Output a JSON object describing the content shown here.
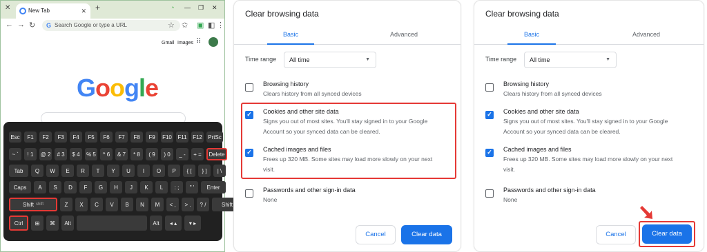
{
  "browser": {
    "tab_title": "New Tab",
    "tab_close": "✕",
    "new_tab": "+",
    "omnibox_placeholder": "Search Google or type a URL",
    "links": {
      "gmail": "Gmail",
      "images": "Images"
    },
    "logo_letters": [
      {
        "ch": "G",
        "color": "#4285f4"
      },
      {
        "ch": "o",
        "color": "#ea4335"
      },
      {
        "ch": "o",
        "color": "#fbbc05"
      },
      {
        "ch": "g",
        "color": "#4285f4"
      },
      {
        "ch": "l",
        "color": "#34a853"
      },
      {
        "ch": "e",
        "color": "#ea4335"
      }
    ],
    "frame_color": "#dfe9d6"
  },
  "keyboard": {
    "rows": [
      [
        "Esc",
        "F1",
        "F2",
        "F3",
        "F4",
        "F5",
        "F6",
        "F7",
        "F8",
        "F9",
        "F10",
        "F11",
        "F12",
        "PrtSc"
      ],
      [
        "~ `",
        "! 1",
        "@ 2",
        "# 3",
        "$ 4",
        "% 5",
        "^ 6",
        "& 7",
        "* 8",
        "( 9",
        ") 0",
        "_ -",
        "+ =",
        "Delete"
      ],
      [
        "Tab",
        "Q",
        "W",
        "E",
        "R",
        "T",
        "Y",
        "U",
        "I",
        "O",
        "P",
        "{ [",
        "} ]",
        "| \\"
      ],
      [
        "Caps",
        "A",
        "S",
        "D",
        "F",
        "G",
        "H",
        "J",
        "K",
        "L",
        ": ;",
        "\" '",
        "Enter"
      ],
      [
        "Shift",
        "Z",
        "X",
        "C",
        "V",
        "B",
        "N",
        "M",
        "< ,",
        "> .",
        "? /",
        "Shift"
      ],
      [
        "Ctrl",
        "⊞",
        "⌘",
        "Alt",
        "",
        "Alt",
        "◂ ▴",
        "▾ ▸"
      ]
    ],
    "shift_sub": "shift",
    "highlighted": [
      "Delete",
      "Shift",
      "Ctrl"
    ]
  },
  "dialog_left": {
    "title": "Clear browsing data",
    "tabs": [
      "Basic",
      "Advanced"
    ],
    "time_range_label": "Time range",
    "time_range_value": "All time",
    "items": [
      {
        "title": "Browsing history",
        "desc": "Clears history from all synced devices",
        "checked": false
      },
      {
        "title": "Cookies and other site data",
        "desc": "Signs you out of most sites. You'll stay signed in to your Google Account so your synced data can be cleared.",
        "checked": true
      },
      {
        "title": "Cached images and files",
        "desc": "Frees up 320 MB. Some sites may load more slowly on your next visit.",
        "checked": true
      },
      {
        "title": "Passwords and other sign-in data",
        "desc": "None",
        "checked": false
      }
    ],
    "cancel_label": "Cancel",
    "clear_label": "Clear data"
  },
  "dialog_right": {
    "title": "Clear browsing data",
    "tabs": [
      "Basic",
      "Advanced"
    ],
    "time_range_label": "Time range",
    "time_range_value": "All time",
    "items": [
      {
        "title": "Browsing history",
        "desc": "Clears history from all synced devices",
        "checked": false
      },
      {
        "title": "Cookies and other site data",
        "desc": "Signs you out of most sites. You'll stay signed in to your Google Account so your synced data can be cleared.",
        "checked": true
      },
      {
        "title": "Cached images and files",
        "desc": "Frees up 320 MB. Some sites may load more slowly on your next visit.",
        "checked": true
      },
      {
        "title": "Passwords and other sign-in data",
        "desc": "None",
        "checked": false
      }
    ],
    "cancel_label": "Cancel",
    "clear_label": "Clear data"
  },
  "colors": {
    "accent": "#1a73e8",
    "highlight": "#e53935"
  }
}
